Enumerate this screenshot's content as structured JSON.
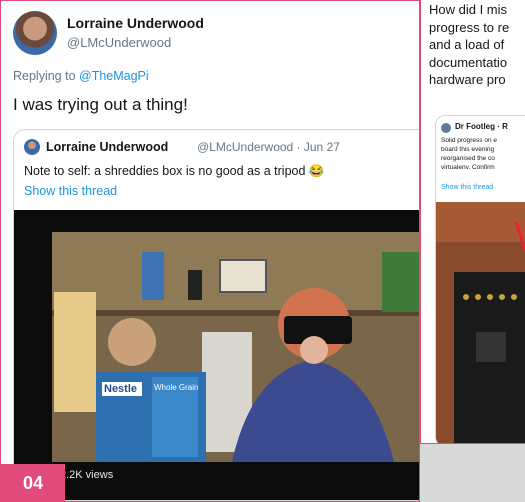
{
  "main_tweet": {
    "author_name": "Lorraine Underwood",
    "author_handle": "@LMcUnderwood",
    "reply_prefix": "Replying to ",
    "reply_to": "@TheMagPi",
    "text": "I was trying out a thing!"
  },
  "quoted_tweet": {
    "author_name": "Lorraine Underwood",
    "meta": "@LMcUnderwood · Jun 27",
    "text": "Note to self: a shreddies box is no good as a tripod 😂",
    "show_thread": "Show this thread"
  },
  "video": {
    "views": "2.2K views",
    "box_brand": "Nestle",
    "box_label": "Whole Grain"
  },
  "side_tweet": {
    "text_lines": [
      "How did I mis",
      "progress to re",
      "and a load of",
      "documentatio",
      "hardware pro"
    ],
    "quote_author": "Dr Footleg · R",
    "quote_lines": [
      "Solid progress on e",
      "board this evening",
      "reorganised the co",
      "virtualenv. Confirm"
    ],
    "show_thread": "Show this thread"
  },
  "badge": "04",
  "colors": {
    "accent": "#e14b7c",
    "link": "#1b95e0",
    "muted": "#657786"
  }
}
